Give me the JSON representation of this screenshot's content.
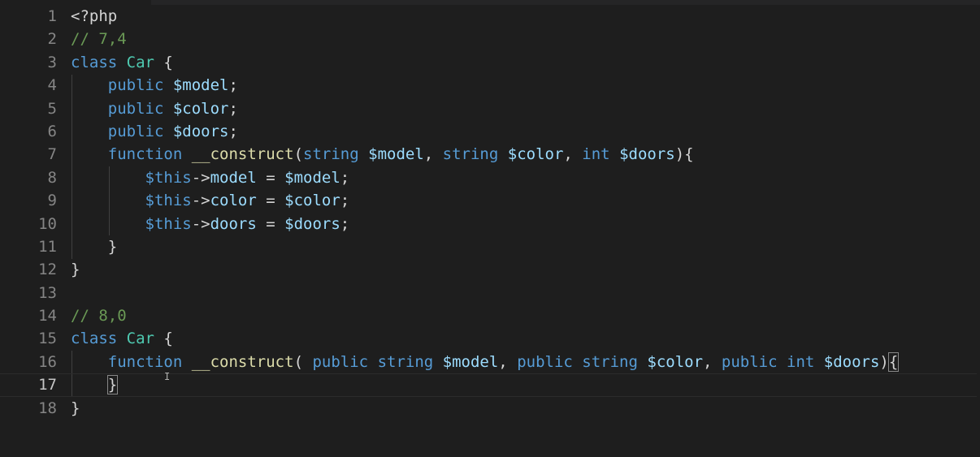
{
  "editor": {
    "language": "php",
    "current_line": 17,
    "lines": [
      {
        "num": "1",
        "tokens": [
          {
            "t": "<?php",
            "c": "tag"
          }
        ]
      },
      {
        "num": "2",
        "tokens": [
          {
            "t": "// 7,4",
            "c": "cmt"
          }
        ]
      },
      {
        "num": "3",
        "tokens": [
          {
            "t": "class",
            "c": "kw"
          },
          {
            "t": " ",
            "c": "pun"
          },
          {
            "t": "Car",
            "c": "cls"
          },
          {
            "t": " {",
            "c": "pun"
          }
        ]
      },
      {
        "num": "4",
        "tokens": [
          {
            "t": "    ",
            "c": "pun"
          },
          {
            "t": "public",
            "c": "kw"
          },
          {
            "t": " ",
            "c": "pun"
          },
          {
            "t": "$model",
            "c": "var"
          },
          {
            "t": ";",
            "c": "pun"
          }
        ]
      },
      {
        "num": "5",
        "tokens": [
          {
            "t": "    ",
            "c": "pun"
          },
          {
            "t": "public",
            "c": "kw"
          },
          {
            "t": " ",
            "c": "pun"
          },
          {
            "t": "$color",
            "c": "var"
          },
          {
            "t": ";",
            "c": "pun"
          }
        ]
      },
      {
        "num": "6",
        "tokens": [
          {
            "t": "    ",
            "c": "pun"
          },
          {
            "t": "public",
            "c": "kw"
          },
          {
            "t": " ",
            "c": "pun"
          },
          {
            "t": "$doors",
            "c": "var"
          },
          {
            "t": ";",
            "c": "pun"
          }
        ]
      },
      {
        "num": "7",
        "tokens": [
          {
            "t": "    ",
            "c": "pun"
          },
          {
            "t": "function",
            "c": "kw"
          },
          {
            "t": " ",
            "c": "pun"
          },
          {
            "t": "__construct",
            "c": "fn"
          },
          {
            "t": "(",
            "c": "pun"
          },
          {
            "t": "string",
            "c": "kw"
          },
          {
            "t": " ",
            "c": "pun"
          },
          {
            "t": "$model",
            "c": "var"
          },
          {
            "t": ", ",
            "c": "pun"
          },
          {
            "t": "string",
            "c": "kw"
          },
          {
            "t": " ",
            "c": "pun"
          },
          {
            "t": "$color",
            "c": "var"
          },
          {
            "t": ", ",
            "c": "pun"
          },
          {
            "t": "int",
            "c": "kw"
          },
          {
            "t": " ",
            "c": "pun"
          },
          {
            "t": "$doors",
            "c": "var"
          },
          {
            "t": "){",
            "c": "pun"
          }
        ]
      },
      {
        "num": "8",
        "tokens": [
          {
            "t": "        ",
            "c": "pun"
          },
          {
            "t": "$this",
            "c": "kw"
          },
          {
            "t": "->",
            "c": "pun"
          },
          {
            "t": "model",
            "c": "var"
          },
          {
            "t": " = ",
            "c": "pun"
          },
          {
            "t": "$model",
            "c": "var"
          },
          {
            "t": ";",
            "c": "pun"
          }
        ]
      },
      {
        "num": "9",
        "tokens": [
          {
            "t": "        ",
            "c": "pun"
          },
          {
            "t": "$this",
            "c": "kw"
          },
          {
            "t": "->",
            "c": "pun"
          },
          {
            "t": "color",
            "c": "var"
          },
          {
            "t": " = ",
            "c": "pun"
          },
          {
            "t": "$color",
            "c": "var"
          },
          {
            "t": ";",
            "c": "pun"
          }
        ]
      },
      {
        "num": "10",
        "tokens": [
          {
            "t": "        ",
            "c": "pun"
          },
          {
            "t": "$this",
            "c": "kw"
          },
          {
            "t": "->",
            "c": "pun"
          },
          {
            "t": "doors",
            "c": "var"
          },
          {
            "t": " = ",
            "c": "pun"
          },
          {
            "t": "$doors",
            "c": "var"
          },
          {
            "t": ";",
            "c": "pun"
          }
        ]
      },
      {
        "num": "11",
        "tokens": [
          {
            "t": "    ",
            "c": "pun"
          },
          {
            "t": "}",
            "c": "pun"
          }
        ]
      },
      {
        "num": "12",
        "tokens": [
          {
            "t": "}",
            "c": "pun"
          }
        ]
      },
      {
        "num": "13",
        "tokens": []
      },
      {
        "num": "14",
        "tokens": [
          {
            "t": "// 8,0",
            "c": "cmt"
          }
        ]
      },
      {
        "num": "15",
        "tokens": [
          {
            "t": "class",
            "c": "kw"
          },
          {
            "t": " ",
            "c": "pun"
          },
          {
            "t": "Car",
            "c": "cls"
          },
          {
            "t": " {",
            "c": "pun"
          }
        ]
      },
      {
        "num": "16",
        "tokens": [
          {
            "t": "    ",
            "c": "pun"
          },
          {
            "t": "function",
            "c": "kw"
          },
          {
            "t": " ",
            "c": "pun"
          },
          {
            "t": "__construct",
            "c": "fn"
          },
          {
            "t": "( ",
            "c": "pun"
          },
          {
            "t": "public",
            "c": "kw"
          },
          {
            "t": " ",
            "c": "pun"
          },
          {
            "t": "string",
            "c": "kw"
          },
          {
            "t": " ",
            "c": "pun"
          },
          {
            "t": "$model",
            "c": "var"
          },
          {
            "t": ", ",
            "c": "pun"
          },
          {
            "t": "public",
            "c": "kw"
          },
          {
            "t": " ",
            "c": "pun"
          },
          {
            "t": "string",
            "c": "kw"
          },
          {
            "t": " ",
            "c": "pun"
          },
          {
            "t": "$color",
            "c": "var"
          },
          {
            "t": ", ",
            "c": "pun"
          },
          {
            "t": "public",
            "c": "kw"
          },
          {
            "t": " ",
            "c": "pun"
          },
          {
            "t": "int",
            "c": "kw"
          },
          {
            "t": " ",
            "c": "pun"
          },
          {
            "t": "$doors",
            "c": "var"
          },
          {
            "t": ")",
            "c": "pun"
          },
          {
            "t": "{",
            "c": "pun",
            "match": true
          }
        ]
      },
      {
        "num": "17",
        "tokens": [
          {
            "t": "    ",
            "c": "pun"
          },
          {
            "t": "}",
            "c": "pun",
            "match": true
          }
        ]
      },
      {
        "num": "18",
        "tokens": [
          {
            "t": "}",
            "c": "pun"
          }
        ]
      }
    ]
  },
  "colors": {
    "background": "#1e1e1e",
    "keyword": "#569cd6",
    "variable": "#9cdcfe",
    "class": "#4ec9b0",
    "function": "#dcdcaa",
    "comment": "#6a9955",
    "text": "#d4d4d4",
    "line_number": "#858585"
  },
  "mouse_cursor_icon": "text-ibeam-icon",
  "mouse_cursor_glyph": "I"
}
